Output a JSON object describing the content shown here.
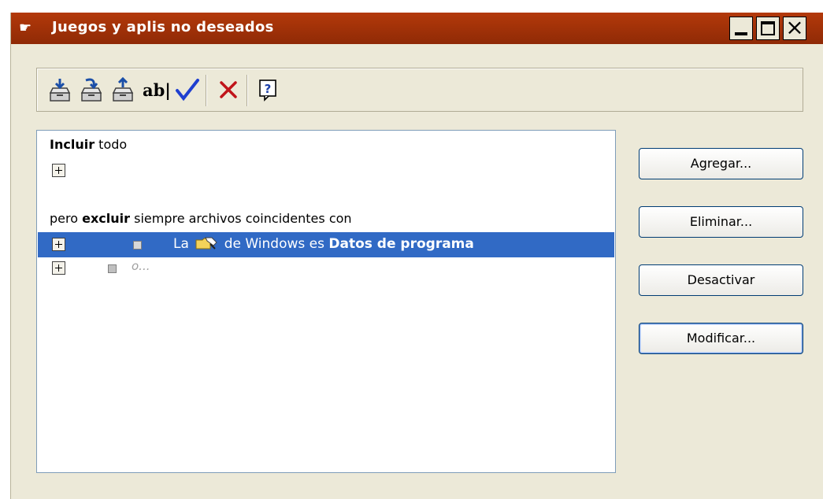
{
  "window": {
    "title": "Juegos y aplis no deseados",
    "controls": [
      "minimize-icon",
      "maximize-icon",
      "close-icon"
    ]
  },
  "toolbar": {
    "tools": [
      {
        "name": "add-icon"
      },
      {
        "name": "add-from-icon"
      },
      {
        "name": "remove-icon"
      },
      {
        "name": "rename-icon",
        "label": "ab|"
      },
      {
        "name": "check-icon"
      },
      {
        "name": "delete-x-icon"
      },
      {
        "name": "help-icon"
      }
    ]
  },
  "list": {
    "include_bold": "Incluir",
    "include_rest": " todo",
    "exclude_prefix": "pero ",
    "exclude_bold": "excluir",
    "exclude_rest": " siempre archivos coincidentes con",
    "selected_row": {
      "pre": "La",
      "mid": "de Windows es",
      "bold": "Datos de programa"
    },
    "or_placeholder": "o..."
  },
  "buttons": {
    "add": "Agregar...",
    "remove": "Eliminar...",
    "disable": "Desactivar",
    "modify": "Modificar..."
  },
  "colors": {
    "titlebar": "#a3330a",
    "selection": "#316ac5",
    "window_bg": "#ece9d8"
  }
}
